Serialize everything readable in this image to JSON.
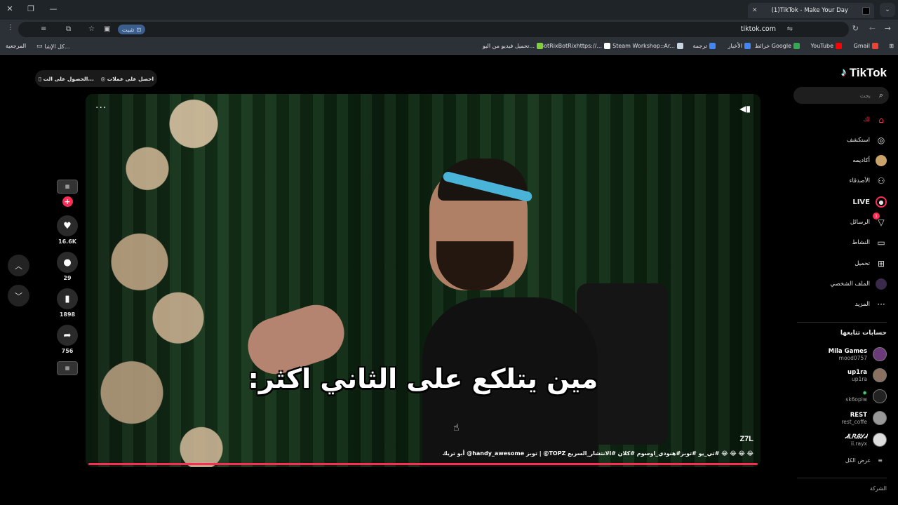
{
  "browser": {
    "tab_title": "(1)TikTok - Make Your Day",
    "url": "tiktok.com",
    "install_label": "تثبيت",
    "bookmarks": [
      {
        "label": "Gmail",
        "color": "#ea4335"
      },
      {
        "label": "YouTube",
        "color": "#ff0000"
      },
      {
        "label": "خرائط Google",
        "color": "#34a853"
      },
      {
        "label": "الأخبار",
        "color": "#4285f4"
      },
      {
        "label": "ترجمة",
        "color": "#4285f4"
      },
      {
        "label": "Steam Workshop::Ar...",
        "color": "#1b2838"
      },
      {
        "label": "BotRixBotRixhttps://...",
        "color": "#ffffff"
      },
      {
        "label": "تحميل فيديو من اليو...",
        "color": "#7fd13b"
      }
    ],
    "bookmarks_left": [
      {
        "label": "كل الإشا..."
      },
      {
        "label": "المرجعية"
      }
    ]
  },
  "tiktok": {
    "logo": "TikTok",
    "search_placeholder": "بحث",
    "nav": [
      {
        "label": "لك",
        "icon": "home-icon",
        "glyph": "⌂",
        "active": true
      },
      {
        "label": "استكشف",
        "icon": "compass-icon",
        "glyph": "◎"
      },
      {
        "label": "أكاديمه",
        "icon": "avatar-icon",
        "glyph": "●"
      },
      {
        "label": "الأصدقاء",
        "icon": "friends-icon",
        "glyph": "⚇"
      },
      {
        "label": "LIVE",
        "icon": "live-icon",
        "glyph": "◉"
      },
      {
        "label": "الرسائل",
        "icon": "messages-icon",
        "glyph": "▽",
        "badge": "1"
      },
      {
        "label": "النشاط",
        "icon": "activity-icon",
        "glyph": "▭"
      },
      {
        "label": "تحميل",
        "icon": "upload-icon",
        "glyph": "⊞"
      },
      {
        "label": "الملف الشخصي",
        "icon": "profile-icon",
        "glyph": "●"
      },
      {
        "label": "المزيد",
        "icon": "more-icon",
        "glyph": "···"
      }
    ],
    "following_title": "حسابات تتابعها",
    "accounts": [
      {
        "name": "Mila Games",
        "handle": "mood0757"
      },
      {
        "name": "up1ra",
        "handle": "up1ra"
      },
      {
        "name": "",
        "handle": "sk6opiw"
      },
      {
        "name": "REST",
        "handle": "rest_coffe"
      },
      {
        "name": "ᏗᏞᏒᎯᎩᏗ",
        "handle": "ii.rayx"
      }
    ],
    "see_all": "عرض الكل",
    "company": "الشركة",
    "get_app_1": "احصل على عملات",
    "get_app_2": "الحصول على الت..."
  },
  "video": {
    "caption": "مين يتلكع على الثاني اكثر:",
    "watermark": "Z7L",
    "description": "😂 😂 😂 😂 #تي_يو #توبز#هنودي_اوسوم #كلان #الانتشار_السريع TOPZ@ | توبز handy_awesome@ أبو تريك",
    "likes": "16.6K",
    "comments": "29",
    "saves": "1898",
    "shares": "756",
    "progress": 1.0
  }
}
